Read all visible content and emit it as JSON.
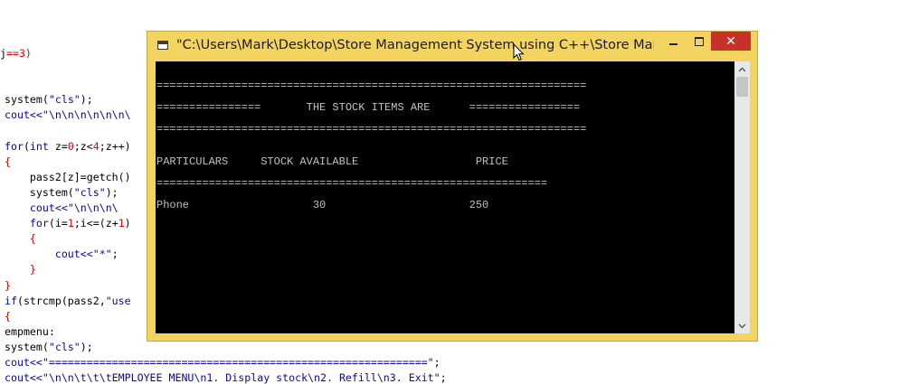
{
  "editor": {
    "lines": [
      [
        {
          "t": "j",
          "c": "pl"
        },
        {
          "t": "==3)",
          "c": "op"
        }
      ],
      [],
      [],
      [
        {
          "t": "system(",
          "c": "pl"
        },
        {
          "t": "\"cls\"",
          "c": "str"
        },
        {
          "t": ");",
          "c": "pl"
        }
      ],
      [
        {
          "t": "cout<<",
          "c": "kw"
        },
        {
          "t": "\"\\n\\n\\n\\n\\n\\n\\",
          "c": "str"
        }
      ],
      [],
      [
        {
          "t": "for",
          "c": "kw"
        },
        {
          "t": "(",
          "c": "pl"
        },
        {
          "t": "int",
          "c": "kw"
        },
        {
          "t": " z=",
          "c": "pl"
        },
        {
          "t": "0",
          "c": "num"
        },
        {
          "t": ";z<",
          "c": "pl"
        },
        {
          "t": "4",
          "c": "num"
        },
        {
          "t": ";z++)",
          "c": "pl"
        }
      ],
      [
        {
          "t": "{",
          "c": "op"
        }
      ],
      [
        {
          "t": "    pass2[z]=getch()",
          "c": "pl"
        }
      ],
      [
        {
          "t": "    system(",
          "c": "pl"
        },
        {
          "t": "\"cls\"",
          "c": "str"
        },
        {
          "t": ");",
          "c": "pl"
        }
      ],
      [
        {
          "t": "    cout<<",
          "c": "kw"
        },
        {
          "t": "\"\\n\\n\\n\\",
          "c": "str"
        }
      ],
      [
        {
          "t": "    for",
          "c": "kw"
        },
        {
          "t": "(i=",
          "c": "pl"
        },
        {
          "t": "1",
          "c": "num"
        },
        {
          "t": ";i<=(z+",
          "c": "pl"
        },
        {
          "t": "1",
          "c": "num"
        },
        {
          "t": ")",
          "c": "pl"
        }
      ],
      [
        {
          "t": "    {",
          "c": "op"
        }
      ],
      [
        {
          "t": "        cout<<",
          "c": "kw"
        },
        {
          "t": "\"*\"",
          "c": "str"
        },
        {
          "t": ";",
          "c": "pl"
        }
      ],
      [
        {
          "t": "    }",
          "c": "op"
        }
      ],
      [
        {
          "t": "}",
          "c": "op"
        }
      ],
      [
        {
          "t": "if",
          "c": "kw"
        },
        {
          "t": "(strcmp(pass2,",
          "c": "pl"
        },
        {
          "t": "\"use",
          "c": "str"
        }
      ],
      [
        {
          "t": "{",
          "c": "op"
        }
      ],
      [
        {
          "t": "empmenu:",
          "c": "pl"
        }
      ],
      [
        {
          "t": "system(",
          "c": "pl"
        },
        {
          "t": "\"cls\"",
          "c": "str"
        },
        {
          "t": ");",
          "c": "pl"
        }
      ],
      [
        {
          "t": "cout<<",
          "c": "kw"
        },
        {
          "t": "\"============================================================\"",
          "c": "str"
        },
        {
          "t": ";",
          "c": "pl"
        }
      ],
      [
        {
          "t": "cout<<",
          "c": "kw"
        },
        {
          "t": "\"\\n\\n\\t\\t\\tEMPLOYEE MENU\\n1. Display stock\\n2. Refill\\n3. Exit\"",
          "c": "str"
        },
        {
          "t": ";",
          "c": "pl"
        }
      ]
    ]
  },
  "window": {
    "title": "\"C:\\Users\\Mark\\Desktop\\Store Management System using C++\\Store Manage...",
    "close_glyph": "✕"
  },
  "console": {
    "lines": [
      "",
      "==================================================================",
      "",
      "================       THE STOCK ITEMS ARE      =================",
      "",
      "==================================================================",
      "",
      "",
      "PARTICULARS     STOCK AVAILABLE                  PRICE",
      "",
      "============================================================",
      "",
      "Phone                   30                      250"
    ]
  },
  "colors": {
    "window_frame": "#f3d461",
    "close_button": "#c7312a",
    "console_bg": "#000000",
    "console_text": "#c0c0c0"
  },
  "icons": {
    "app": "console-app-icon",
    "minimize": "minimize-icon",
    "maximize": "maximize-icon",
    "close": "close-icon",
    "scroll_up": "chevron-up-icon",
    "scroll_down": "chevron-down-icon",
    "cursor": "mouse-cursor-icon"
  }
}
